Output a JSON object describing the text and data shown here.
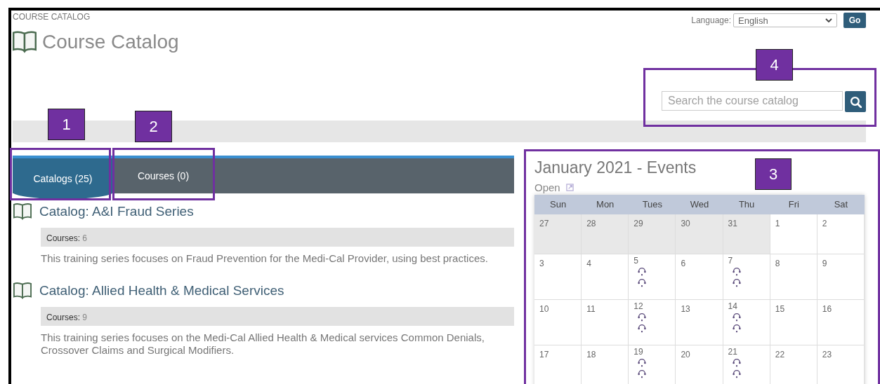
{
  "breadcrumb": "COURSE CATALOG",
  "page_title": "Course Catalog",
  "language": {
    "label": "Language:",
    "value": "English",
    "button": "Go"
  },
  "search": {
    "placeholder": "Search the course catalog"
  },
  "tabs": [
    {
      "label": "Catalogs (25)",
      "selected": true
    },
    {
      "label": "Courses (0)",
      "selected": false
    }
  ],
  "catalogs": [
    {
      "title": "Catalog: A&I Fraud Series",
      "courses_label": "Courses:",
      "courses_count": "6",
      "description": "This training series focuses on Fraud Prevention for the Medi-Cal Provider, using best practices."
    },
    {
      "title": "Catalog: Allied Health & Medical Services",
      "courses_label": "Courses:",
      "courses_count": "9",
      "description": "This training series focuses on the Medi-Cal Allied Health & Medical services Common Denials, Crossover Claims and Surgical Modifiers."
    }
  ],
  "calendar": {
    "title": "January 2021 - Events",
    "link": "Open",
    "weekdays": [
      "Sun",
      "Mon",
      "Tues",
      "Wed",
      "Thu",
      "Fri",
      "Sat"
    ],
    "weeks": [
      [
        {
          "day": "27",
          "outside_month": true
        },
        {
          "day": "28",
          "outside_month": true
        },
        {
          "day": "29",
          "outside_month": true
        },
        {
          "day": "30",
          "outside_month": true
        },
        {
          "day": "31",
          "outside_month": true
        },
        {
          "day": "1",
          "outside_month": false
        },
        {
          "day": "2",
          "outside_month": false
        }
      ],
      [
        {
          "day": "3",
          "outside_month": false
        },
        {
          "day": "4",
          "outside_month": false
        },
        {
          "day": "5",
          "outside_month": false,
          "events": [
            {
              "kind": "webinar"
            },
            {
              "kind": "webinar"
            }
          ]
        },
        {
          "day": "6",
          "outside_month": false
        },
        {
          "day": "7",
          "outside_month": false,
          "events": [
            {
              "kind": "webinar"
            },
            {
              "kind": "webinar"
            }
          ]
        },
        {
          "day": "8",
          "outside_month": false
        },
        {
          "day": "9",
          "outside_month": false
        }
      ],
      [
        {
          "day": "10",
          "outside_month": false
        },
        {
          "day": "11",
          "outside_month": false
        },
        {
          "day": "12",
          "outside_month": false,
          "events": [
            {
              "kind": "webinar"
            },
            {
              "kind": "webinar"
            }
          ]
        },
        {
          "day": "13",
          "outside_month": false
        },
        {
          "day": "14",
          "outside_month": false,
          "events": [
            {
              "kind": "webinar"
            },
            {
              "kind": "webinar"
            }
          ]
        },
        {
          "day": "15",
          "outside_month": false
        },
        {
          "day": "16",
          "outside_month": false
        }
      ],
      [
        {
          "day": "17",
          "outside_month": false
        },
        {
          "day": "18",
          "outside_month": false
        },
        {
          "day": "19",
          "outside_month": false,
          "events": [
            {
              "kind": "webinar"
            },
            {
              "kind": "webinar"
            }
          ]
        },
        {
          "day": "20",
          "outside_month": false
        },
        {
          "day": "21",
          "outside_month": false,
          "events": [
            {
              "kind": "webinar"
            },
            {
              "kind": "webinar"
            }
          ]
        },
        {
          "day": "22",
          "outside_month": false
        },
        {
          "day": "23",
          "outside_month": false
        }
      ]
    ]
  },
  "callouts": [
    {
      "label": "1"
    },
    {
      "label": "2"
    },
    {
      "label": "3"
    },
    {
      "label": "4"
    }
  ]
}
